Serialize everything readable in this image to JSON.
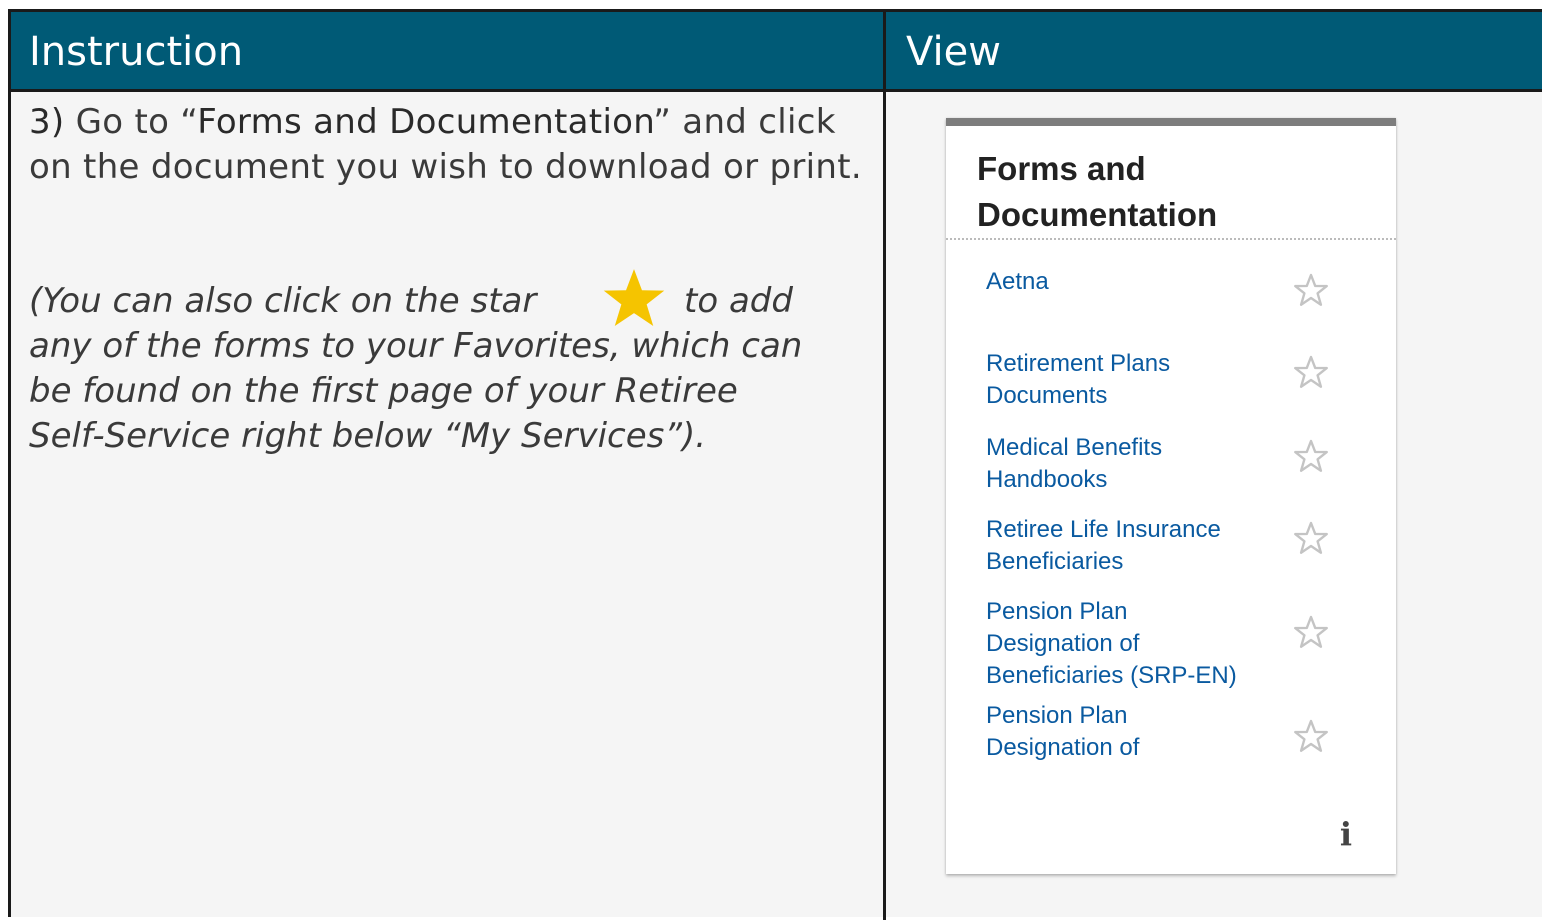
{
  "header": {
    "instruction_label": "Instruction",
    "view_label": "View"
  },
  "instruction": {
    "step": "3)",
    "text_1": " Go to “",
    "highlight": "Forms and Documentation",
    "text_2": "” and click on the document you wish to download or print.",
    "note_line1_before_star": "(You can also click on the star",
    "note_line1_after_star": "to add",
    "note_line2": "any of the forms to your Favorites, which can",
    "note_line3": "be found on the first page of your Retiree",
    "note_line4": "Self-Service right below “My Services”).",
    "star_color": "#f5c400"
  },
  "widget": {
    "title_line1": "Forms and",
    "title_line2": "Documentation",
    "link_color": "#0a5aa0",
    "items": [
      {
        "line1": "Aetna",
        "line2": "",
        "line3": ""
      },
      {
        "line1": "Retirement Plans",
        "line2": "Documents",
        "line3": ""
      },
      {
        "line1": "Medical Benefits",
        "line2": "Handbooks",
        "line3": ""
      },
      {
        "line1": "Retiree Life Insurance",
        "line2": "Beneficiaries",
        "line3": ""
      },
      {
        "line1": "Pension Plan",
        "line2": "Designation of",
        "line3": "Beneficiaries (SRP-EN)"
      },
      {
        "line1": "Pension Plan",
        "line2": "Designation of",
        "line3": ""
      }
    ],
    "info_icon_glyph": "i"
  }
}
